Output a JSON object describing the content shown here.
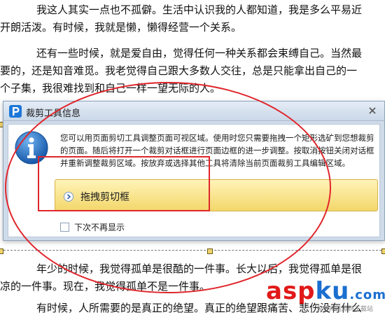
{
  "document": {
    "paragraphs": [
      {
        "lines": [
          "我这人其实一点也不孤僻。生活中认识我的人都知道，我是多么平易近",
          "开朗活泼。有时候，我就是懒，懒得经营一个关系。"
        ]
      },
      {
        "lines": [
          "还有一些时候，就是爱自由，觉得任何一种关系都会束缚自己。当然最",
          "要的，还是知音难觅。我老觉得自己跟大多数人交往，总是只能拿出自己的一",
          "个子集，我很难找到和自己一样一望无际的人。"
        ]
      },
      {
        "lines": [
          "年少的时候，我觉得孤单是很酷的一件事。长大以后，我觉得孤单是很",
          "凉的一件事。现在，我觉得孤单不是一件事。"
        ]
      },
      {
        "lines": [
          "有时候，人所需要的是真正的绝望。真正的绝望跟痛苦、悲伤没有什么"
        ]
      }
    ]
  },
  "dialog": {
    "title": "裁剪工具信息",
    "message": "您可以用页面剪切工具调整页面可视区域。使用时您只需要拖拽一个矩形选矿到您想裁剪的页面。随后将打开一个裁剪对话框进行页面边框的进一步调整。按取消按钮关闭对话框并重新调整裁剪区域。按放弃或选择其他工具将清除当前页面裁剪工具编辑区域。",
    "command_label": "拖拽剪切框",
    "checkbox_label": "下次不再显示",
    "checkbox_checked": false
  },
  "icons": {
    "app": "app-p-icon",
    "close": "close-icon",
    "info": "info-icon",
    "arrow": "chevron-right-icon"
  },
  "watermark": {
    "asp": "asp",
    "ku": "ku",
    "suffix": ".com",
    "subtitle": "免费网站源码下载站"
  },
  "colors": {
    "annotation_red": "#e0262c",
    "accent_blue": "#1d77d8",
    "button_gold": "#f3d76a"
  }
}
